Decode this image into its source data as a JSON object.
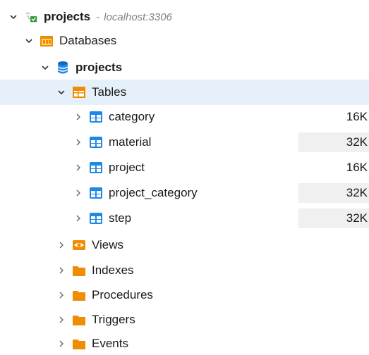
{
  "connection": {
    "name": "projects",
    "separator": "-",
    "host": "localhost:3306"
  },
  "databases_label": "Databases",
  "database": {
    "name": "projects"
  },
  "tables_label": "Tables",
  "tables": [
    {
      "name": "category",
      "size": "16K"
    },
    {
      "name": "material",
      "size": "32K"
    },
    {
      "name": "project",
      "size": "16K"
    },
    {
      "name": "project_category",
      "size": "32K"
    },
    {
      "name": "step",
      "size": "32K"
    }
  ],
  "folders": {
    "views": "Views",
    "indexes": "Indexes",
    "procedures": "Procedures",
    "triggers": "Triggers",
    "events": "Events"
  },
  "colors": {
    "selection": "#e5f0fb",
    "folder_orange": "#f08c00",
    "table_blue": "#1e88e5",
    "db_blue": "#1565c0",
    "size_bg": "#f0f0f0"
  }
}
